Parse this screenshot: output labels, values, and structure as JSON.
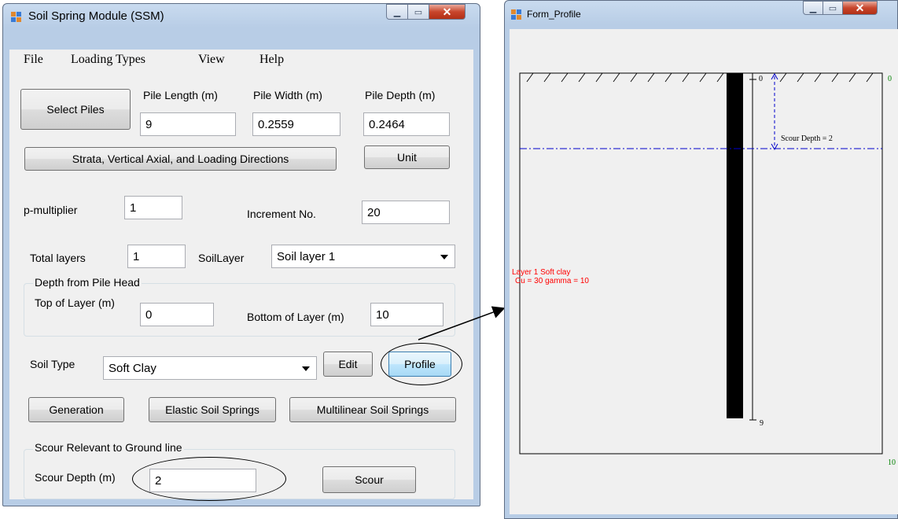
{
  "ssm": {
    "title": "Soil Spring Module (SSM)",
    "menu": [
      "File",
      "Loading Types",
      "View",
      "Help"
    ],
    "select_piles": "Select Piles",
    "pile_length_label": "Pile Length (m)",
    "pile_length": "9",
    "pile_width_label": "Pile Width (m)",
    "pile_width": "0.2559",
    "pile_depth_label": "Pile Depth (m)",
    "pile_depth": "0.2464",
    "strata_button": "Strata, Vertical Axial, and Loading Directions",
    "unit_button": "Unit",
    "p_multiplier_label": "p-multiplier",
    "p_multiplier": "1",
    "increment_label": "Increment No.",
    "increment": "20",
    "total_layers_label": "Total layers",
    "total_layers": "1",
    "soil_layer_label": "SoilLayer",
    "soil_layer": "Soil layer 1",
    "depth_group": "Depth from Pile Head",
    "top_label": "Top of Layer (m)",
    "top_value": "0",
    "bottom_label": "Bottom of Layer (m)",
    "bottom_value": "10",
    "soil_type_label": "Soil Type",
    "soil_type": "Soft Clay",
    "edit_button": "Edit",
    "profile_button": "Profile",
    "generation_button": "Generation",
    "elastic_button": "Elastic Soil Springs",
    "multilinear_button": "Multilinear Soil Springs",
    "scour_group": "Scour Relevant to Ground line",
    "scour_depth_label": "Scour Depth (m)",
    "scour_depth": "2",
    "scour_button": "Scour"
  },
  "profile": {
    "title": "Form_Profile",
    "pile_top_label": "0",
    "pile_bottom_label": "9",
    "scour_label": "Scour Depth = 2",
    "right_top_label": "0",
    "right_bottom_label": "10",
    "layer_line1": "Layer 1 Soft clay",
    "layer_line2": "Cu = 30 gamma = 10"
  },
  "colors": {
    "profile_dashline": "#0000cc",
    "profile_red": "#ff0000",
    "profile_green": "#008000"
  }
}
